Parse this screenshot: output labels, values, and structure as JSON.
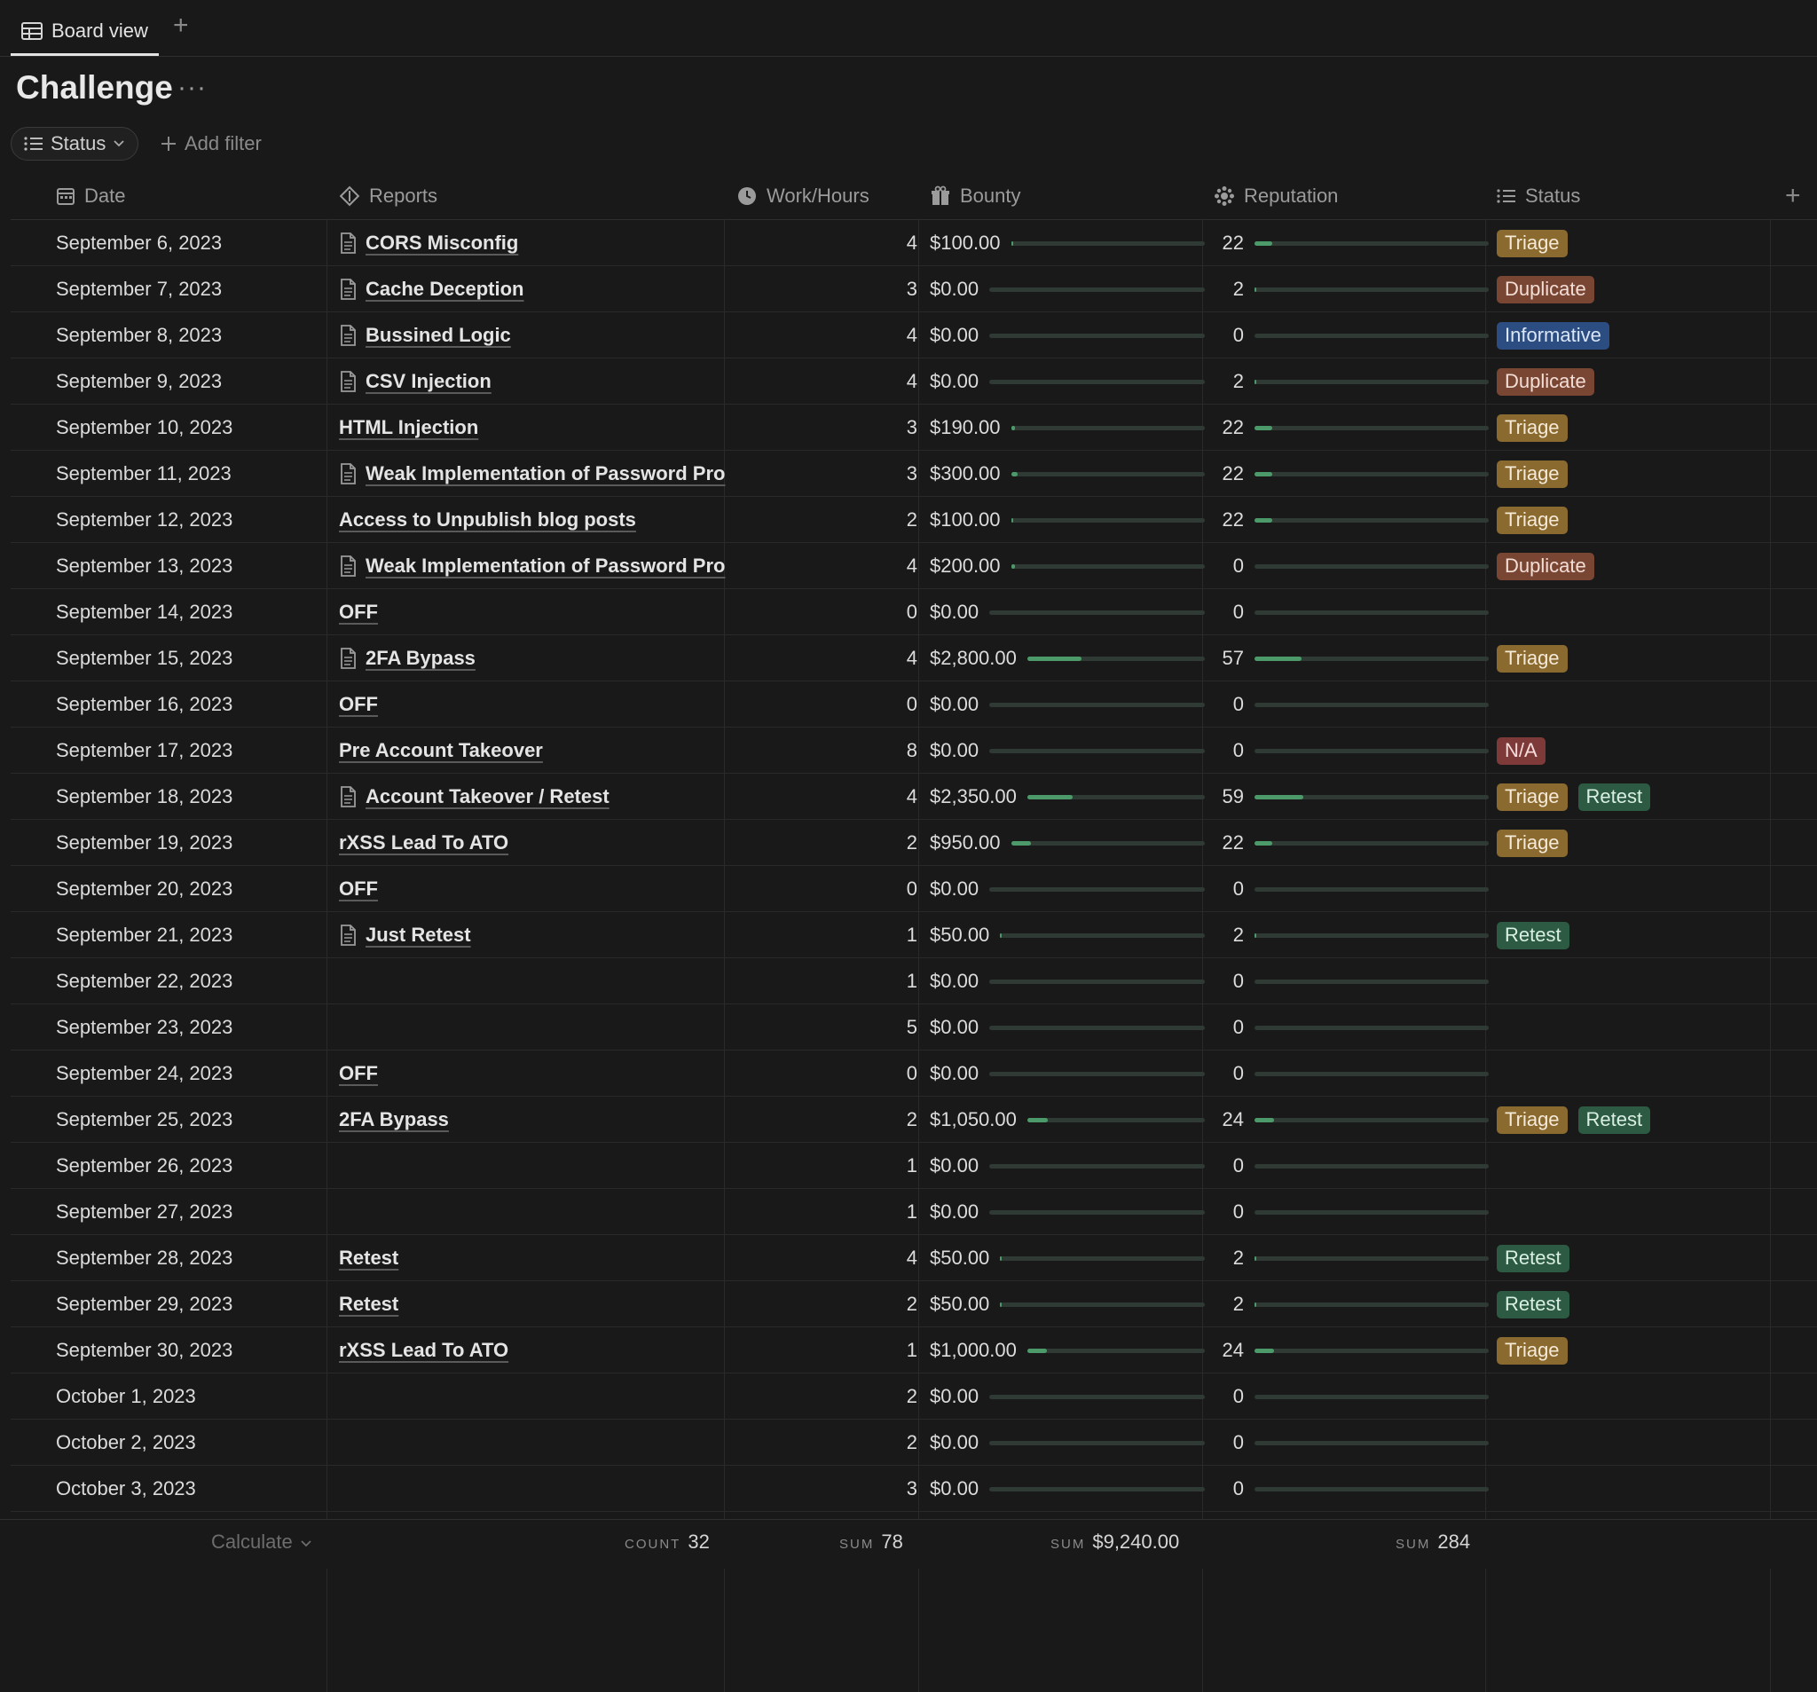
{
  "tabbar": {
    "tab_label": "Board view",
    "add_symbol": "+"
  },
  "page": {
    "title": "Challenge",
    "more_symbol": "···"
  },
  "filters": {
    "status_label": "Status",
    "add_filter_label": "Add filter"
  },
  "columns": {
    "date": "Date",
    "reports": "Reports",
    "hours": "Work/Hours",
    "bounty": "Bounty",
    "reputation": "Reputation",
    "status": "Status",
    "add_symbol": "+"
  },
  "bounty_max": 9240,
  "reputation_max": 284,
  "rows": [
    {
      "date": "September 6, 2023",
      "report": "CORS Misconfig",
      "doc": true,
      "hours": "4",
      "bounty": "$100.00",
      "bounty_value": 100,
      "reputation": "22",
      "statuses": [
        "Triage"
      ]
    },
    {
      "date": "September 7, 2023",
      "report": "Cache Deception",
      "doc": true,
      "hours": "3",
      "bounty": "$0.00",
      "bounty_value": 0,
      "reputation": "2",
      "statuses": [
        "Duplicate"
      ]
    },
    {
      "date": "September 8, 2023",
      "report": "Bussined Logic",
      "doc": true,
      "hours": "4",
      "bounty": "$0.00",
      "bounty_value": 0,
      "reputation": "0",
      "statuses": [
        "Informative"
      ]
    },
    {
      "date": "September 9, 2023",
      "report": "CSV Injection",
      "doc": true,
      "hours": "4",
      "bounty": "$0.00",
      "bounty_value": 0,
      "reputation": "2",
      "statuses": [
        "Duplicate"
      ]
    },
    {
      "date": "September 10, 2023",
      "report": "HTML Injection",
      "doc": false,
      "hours": "3",
      "bounty": "$190.00",
      "bounty_value": 190,
      "reputation": "22",
      "statuses": [
        "Triage"
      ]
    },
    {
      "date": "September 11, 2023",
      "report": "Weak Implementation of Password Pro",
      "doc": true,
      "hours": "3",
      "bounty": "$300.00",
      "bounty_value": 300,
      "reputation": "22",
      "statuses": [
        "Triage"
      ]
    },
    {
      "date": "September 12, 2023",
      "report": "Access to Unpublish blog posts",
      "doc": false,
      "hours": "2",
      "bounty": "$100.00",
      "bounty_value": 100,
      "reputation": "22",
      "statuses": [
        "Triage"
      ]
    },
    {
      "date": "September 13, 2023",
      "report": "Weak Implementation of Password Pro",
      "doc": true,
      "hours": "4",
      "bounty": "$200.00",
      "bounty_value": 200,
      "reputation": "0",
      "statuses": [
        "Duplicate"
      ]
    },
    {
      "date": "September 14, 2023",
      "report": "OFF",
      "doc": false,
      "hours": "0",
      "bounty": "$0.00",
      "bounty_value": 0,
      "reputation": "0",
      "statuses": []
    },
    {
      "date": "September 15, 2023",
      "report": "2FA Bypass",
      "doc": true,
      "hours": "4",
      "bounty": "$2,800.00",
      "bounty_value": 2800,
      "reputation": "57",
      "statuses": [
        "Triage"
      ]
    },
    {
      "date": "September 16, 2023",
      "report": "OFF",
      "doc": false,
      "hours": "0",
      "bounty": "$0.00",
      "bounty_value": 0,
      "reputation": "0",
      "statuses": []
    },
    {
      "date": "September 17, 2023",
      "report": "Pre Account Takeover",
      "doc": false,
      "hours": "8",
      "bounty": "$0.00",
      "bounty_value": 0,
      "reputation": "0",
      "statuses": [
        "N/A"
      ]
    },
    {
      "date": "September 18, 2023",
      "report": "Account Takeover / Retest",
      "doc": true,
      "hours": "4",
      "bounty": "$2,350.00",
      "bounty_value": 2350,
      "reputation": "59",
      "statuses": [
        "Triage",
        "Retest"
      ]
    },
    {
      "date": "September 19, 2023",
      "report": "rXSS Lead To ATO",
      "doc": false,
      "hours": "2",
      "bounty": "$950.00",
      "bounty_value": 950,
      "reputation": "22",
      "statuses": [
        "Triage"
      ]
    },
    {
      "date": "September 20, 2023",
      "report": "OFF",
      "doc": false,
      "hours": "0",
      "bounty": "$0.00",
      "bounty_value": 0,
      "reputation": "0",
      "statuses": []
    },
    {
      "date": "September 21, 2023",
      "report": "Just Retest",
      "doc": true,
      "hours": "1",
      "bounty": "$50.00",
      "bounty_value": 50,
      "reputation": "2",
      "statuses": [
        "Retest"
      ]
    },
    {
      "date": "September 22, 2023",
      "report": "",
      "doc": false,
      "hours": "1",
      "bounty": "$0.00",
      "bounty_value": 0,
      "reputation": "0",
      "statuses": []
    },
    {
      "date": "September 23, 2023",
      "report": "",
      "doc": false,
      "hours": "5",
      "bounty": "$0.00",
      "bounty_value": 0,
      "reputation": "0",
      "statuses": []
    },
    {
      "date": "September 24, 2023",
      "report": "OFF",
      "doc": false,
      "hours": "0",
      "bounty": "$0.00",
      "bounty_value": 0,
      "reputation": "0",
      "statuses": []
    },
    {
      "date": "September 25, 2023",
      "report": "2FA Bypass",
      "doc": false,
      "hours": "2",
      "bounty": "$1,050.00",
      "bounty_value": 1050,
      "reputation": "24",
      "statuses": [
        "Triage",
        "Retest"
      ]
    },
    {
      "date": "September 26, 2023",
      "report": "",
      "doc": false,
      "hours": "1",
      "bounty": "$0.00",
      "bounty_value": 0,
      "reputation": "0",
      "statuses": []
    },
    {
      "date": "September 27, 2023",
      "report": "",
      "doc": false,
      "hours": "1",
      "bounty": "$0.00",
      "bounty_value": 0,
      "reputation": "0",
      "statuses": []
    },
    {
      "date": "September 28, 2023",
      "report": "Retest",
      "doc": false,
      "hours": "4",
      "bounty": "$50.00",
      "bounty_value": 50,
      "reputation": "2",
      "statuses": [
        "Retest"
      ]
    },
    {
      "date": "September 29, 2023",
      "report": "Retest",
      "doc": false,
      "hours": "2",
      "bounty": "$50.00",
      "bounty_value": 50,
      "reputation": "2",
      "statuses": [
        "Retest"
      ]
    },
    {
      "date": "September 30, 2023",
      "report": "rXSS Lead To ATO",
      "doc": false,
      "hours": "1",
      "bounty": "$1,000.00",
      "bounty_value": 1000,
      "reputation": "24",
      "statuses": [
        "Triage"
      ]
    },
    {
      "date": "October 1, 2023",
      "report": "",
      "doc": false,
      "hours": "2",
      "bounty": "$0.00",
      "bounty_value": 0,
      "reputation": "0",
      "statuses": []
    },
    {
      "date": "October 2, 2023",
      "report": "",
      "doc": false,
      "hours": "2",
      "bounty": "$0.00",
      "bounty_value": 0,
      "reputation": "0",
      "statuses": []
    },
    {
      "date": "October 3, 2023",
      "report": "",
      "doc": false,
      "hours": "3",
      "bounty": "$0.00",
      "bounty_value": 0,
      "reputation": "0",
      "statuses": []
    }
  ],
  "footer": {
    "calculate_label": "Calculate",
    "count_label": "COUNT",
    "count_value": "32",
    "hours_label": "SUM",
    "hours_value": "78",
    "bounty_label": "SUM",
    "bounty_value": "$9,240.00",
    "rep_label": "SUM",
    "rep_value": "284"
  }
}
